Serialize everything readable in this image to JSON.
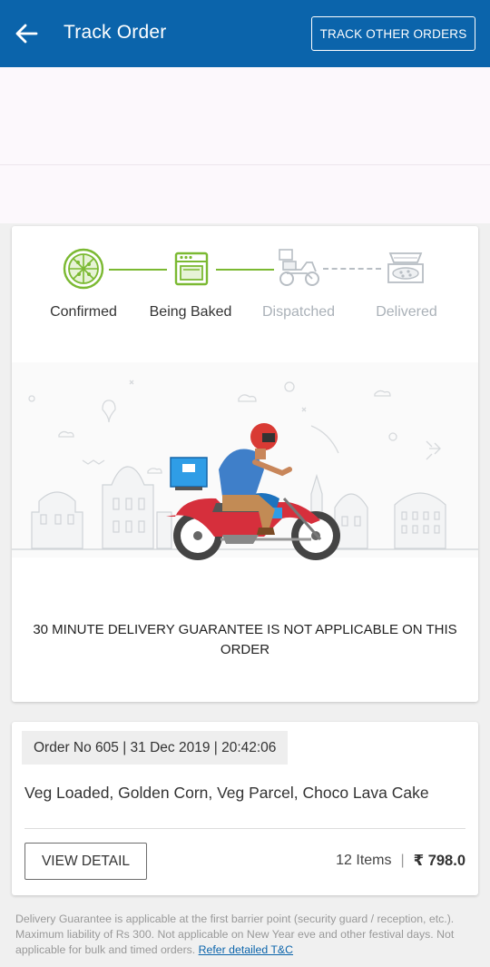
{
  "header": {
    "title": "Track Order",
    "track_other_label": "TRACK OTHER ORDERS"
  },
  "tracker": {
    "steps": [
      {
        "label": "Confirmed",
        "state": "done",
        "icon": "pizza-icon"
      },
      {
        "label": "Being Baked",
        "state": "done",
        "icon": "oven-icon"
      },
      {
        "label": "Dispatched",
        "state": "pending",
        "icon": "delivery-scooter-icon"
      },
      {
        "label": "Delivered",
        "state": "pending",
        "icon": "pizza-box-icon"
      }
    ],
    "guarantee_notice": "30 MINUTE DELIVERY GUARANTEE IS NOT APPLICABLE ON THIS ORDER"
  },
  "order": {
    "meta": "Order No 605 | 31 Dec 2019 | 20:42:06",
    "items_text": "Veg Loaded, Golden Corn, Veg Parcel,  Choco Lava Cake",
    "view_detail_label": "VIEW DETAIL",
    "item_count": "12 Items",
    "separator": "|",
    "price": "₹ 798.0"
  },
  "footer": {
    "disclaimer": "Delivery Guarantee is applicable at the first barrier point (security guard / reception, etc.). Maximum liability of Rs 300. Not applicable on New Year eve and other festival days. Not applicable for bulk and timed orders. ",
    "tnc_link": "Refer detailed T&C"
  },
  "colors": {
    "primary": "#0b64ab",
    "done_green": "#7bb932",
    "pending_grey": "#aab1b8"
  }
}
